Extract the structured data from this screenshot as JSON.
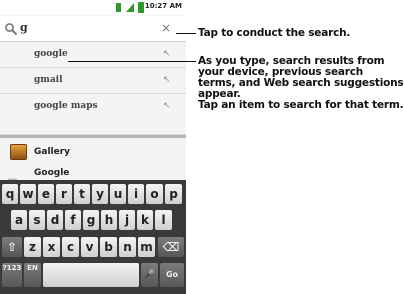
{
  "status_bar": {
    "time": "10:27 AM"
  },
  "search": {
    "query": "g",
    "clear_symbol": "×"
  },
  "suggestions": [
    {
      "text": "google",
      "arrow": "↖"
    },
    {
      "text": "gmail",
      "arrow": "↖"
    },
    {
      "text": "google maps",
      "arrow": "↖"
    }
  ],
  "apps": [
    {
      "name": "Gallery"
    },
    {
      "name": "Google"
    }
  ],
  "keyboard": {
    "row1": [
      "q",
      "w",
      "e",
      "r",
      "t",
      "y",
      "u",
      "i",
      "o",
      "p"
    ],
    "row2": [
      "a",
      "s",
      "d",
      "f",
      "g",
      "h",
      "j",
      "k",
      "l"
    ],
    "row3": [
      "z",
      "x",
      "c",
      "v",
      "b",
      "n",
      "m"
    ],
    "shift": "⇧",
    "delete": "⌫",
    "symbols_label": "?123",
    "lang_label": "EN",
    "mic": "🎤",
    "go": "Go"
  },
  "callouts": {
    "search": "Tap to conduct the search.",
    "suggestions": [
      "As you type, search results from",
      "your device, previous search",
      "terms, and Web search suggestions",
      "appear.",
      "Tap an item to search for that term."
    ]
  }
}
